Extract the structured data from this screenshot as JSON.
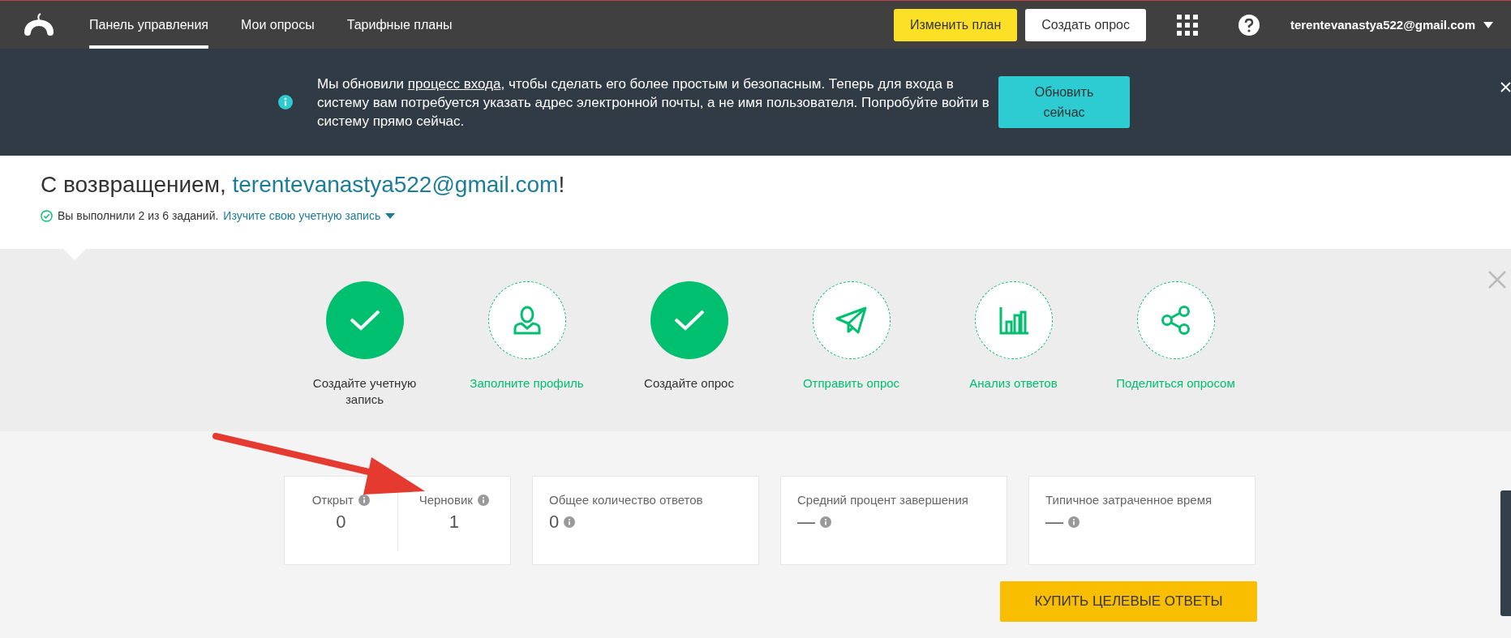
{
  "header": {
    "nav": [
      {
        "label": "Панель управления",
        "selected": true
      },
      {
        "label": "Мои опросы",
        "selected": false
      },
      {
        "label": "Тарифные планы",
        "selected": false
      }
    ],
    "upgrade_button": "Изменить план",
    "create_button": "Создать опрос",
    "user": "terentevanastya522@gmail.com"
  },
  "banner": {
    "before": "Мы обновили ",
    "link": "процесс входа",
    "after": ", чтобы сделать его более простым и безопасным. Теперь для входа в систему вам потребуется указать адрес электронной почты, а не имя пользователя. Попробуйте войти в систему прямо сейчас.",
    "button": "Обновить сейчас"
  },
  "welcome": {
    "greeting": "С возвращением, ",
    "email": "terentevanastya522@gmail.com",
    "end": "!",
    "progress": "Вы выполнили 2 из 6 заданий.",
    "explore_link": "Изучите свою учетную запись"
  },
  "steps": [
    {
      "label": "Создайте учетную запись",
      "done": true
    },
    {
      "label": "Заполните профиль",
      "done": false,
      "kind": "user"
    },
    {
      "label": "Создайте опрос",
      "done": true
    },
    {
      "label": "Отправить опрос",
      "done": false,
      "kind": "send"
    },
    {
      "label": "Анализ ответов",
      "done": false,
      "kind": "chart"
    },
    {
      "label": "Поделиться опросом",
      "done": false,
      "kind": "share"
    }
  ],
  "stats": [
    {
      "kind": "split",
      "parts": [
        {
          "label": "Открыт",
          "value": "0"
        },
        {
          "label": "Черновик",
          "value": "1"
        }
      ]
    },
    {
      "kind": "single",
      "label": "Общее количество ответов",
      "value": "0"
    },
    {
      "kind": "single",
      "label": "Средний процент завершения",
      "value": "—"
    },
    {
      "kind": "single",
      "label": "Типичное затраченное время",
      "value": "—"
    }
  ],
  "buy_button": "КУПИТЬ ЦЕЛЕВЫЕ ОТВЕТЫ"
}
